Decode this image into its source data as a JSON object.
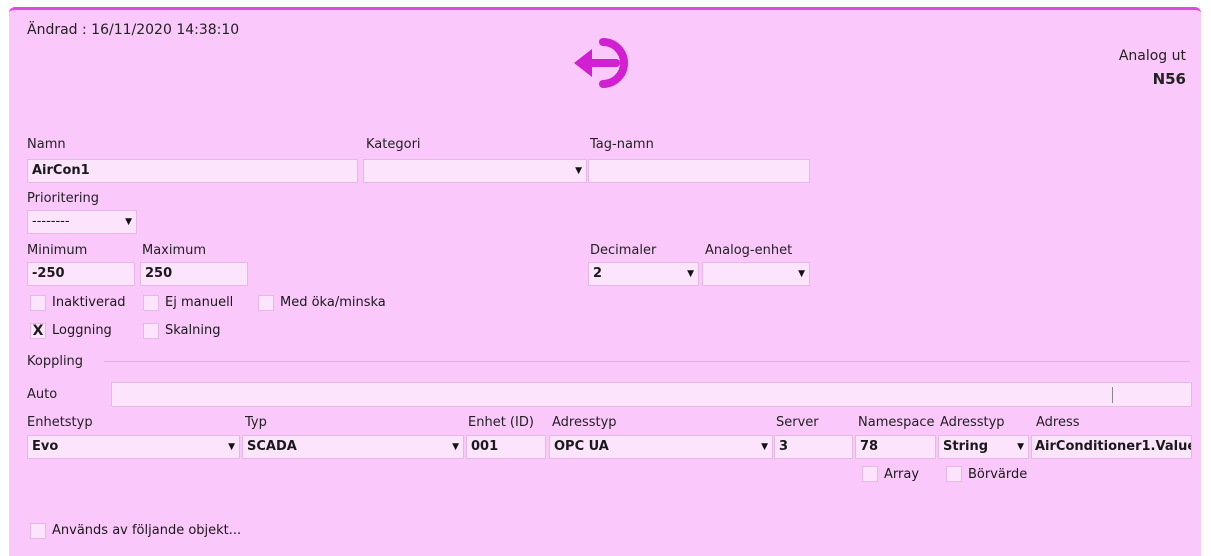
{
  "header": {
    "modified": "Ändrad : 16/11/2020 14:38:10",
    "type_label": "Analog ut",
    "id_label": "N56",
    "icon": "logout-arrow-icon",
    "accent_color": "#d21fd2"
  },
  "fields": {
    "name_label": "Namn",
    "name_value": "AirCon1",
    "category_label": "Kategori",
    "category_value": "",
    "tag_label": "Tag-namn",
    "tag_value": "",
    "priority_label": "Prioritering",
    "priority_value": "--------",
    "min_label": "Minimum",
    "min_value": "-250",
    "max_label": "Maximum",
    "max_value": "250",
    "decimals_label": "Decimaler",
    "decimals_value": "2",
    "unit_label": "Analog-enhet",
    "unit_value": ""
  },
  "checkboxes": {
    "inactive": {
      "label": "Inaktiverad",
      "checked": false
    },
    "not_manual": {
      "label": "Ej manuell",
      "checked": false
    },
    "inc_dec": {
      "label": "Med öka/minska",
      "checked": false
    },
    "logging": {
      "label": "Loggning",
      "checked": true,
      "mark": "X"
    },
    "scaling": {
      "label": "Skalning",
      "checked": false
    }
  },
  "connection": {
    "section_label": "Koppling",
    "auto_label": "Auto",
    "device_type_label": "Enhetstyp",
    "device_type_value": "Evo",
    "type_label": "Typ",
    "type_value": "SCADA",
    "unit_id_label": "Enhet (ID)",
    "unit_id_value": "001",
    "address_type_label": "Adresstyp",
    "address_type_value": "OPC UA",
    "server_label": "Server",
    "server_value": "3",
    "namespace_label": "Namespace",
    "namespace_value": "78",
    "address_type2_label": "Adresstyp",
    "address_type2_value": "String",
    "address_label": "Adress",
    "address_value": "AirConditioner1.Value",
    "array_label": "Array",
    "setpoint_label": "Börvärde"
  },
  "footer": {
    "used_by_label": "Används av följande objekt..."
  },
  "dropdown_arrow": "▼"
}
